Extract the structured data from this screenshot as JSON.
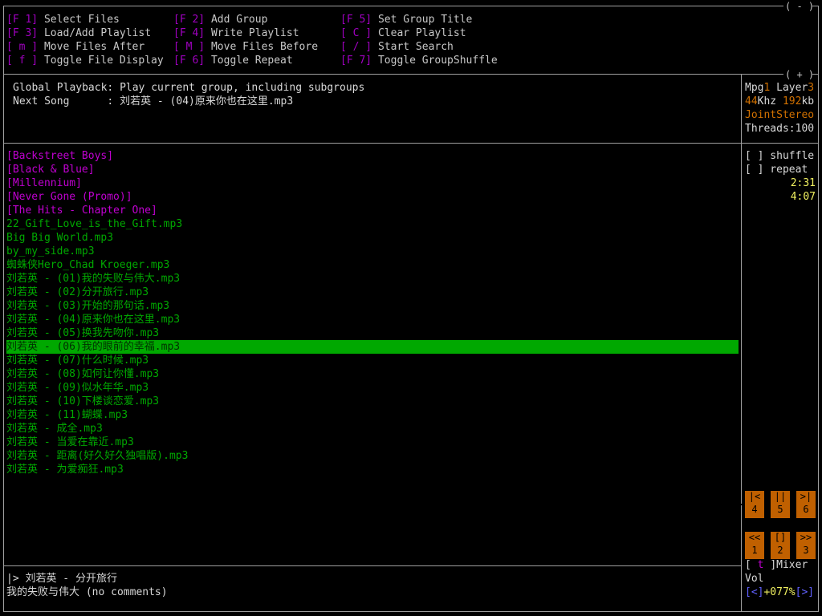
{
  "window_controls": {
    "minimize": "( - )",
    "expand": "( + )"
  },
  "keys": [
    {
      "key": "[F 1]",
      "label": "Select Files"
    },
    {
      "key": "[F 2]",
      "label": "Add Group"
    },
    {
      "key": "[F 5]",
      "label": "Set Group Title"
    },
    {
      "key": "[F 3]",
      "label": "Load/Add Playlist"
    },
    {
      "key": "[F 4]",
      "label": "Write Playlist"
    },
    {
      "key": "[ C ]",
      "label": "Clear Playlist"
    },
    {
      "key": "[ m ]",
      "label": "Move Files After"
    },
    {
      "key": "[ M ]",
      "label": "Move Files Before"
    },
    {
      "key": "[ / ]",
      "label": "Start Search"
    },
    {
      "key": "[ f ]",
      "label": "Toggle File Display"
    },
    {
      "key": "[F 6]",
      "label": "Toggle Repeat"
    },
    {
      "key": "[F 7]",
      "label": "Toggle GroupShuffle"
    }
  ],
  "info": {
    "global_label": "Global Playback:",
    "global_value": "Play current group, including subgroups",
    "next_label": "Next Song      :",
    "next_value": "刘若英 - (04)原来你也在这里.mp3"
  },
  "stream": {
    "mpg_label": "Mpg",
    "mpg_value": "1",
    "layer_label": "Layer",
    "layer_value": "3",
    "khz_value": "44",
    "khz_label": "Khz",
    "kb_value": "192",
    "kb_label": "kb",
    "mode": "JointStereo",
    "threads": "Threads:100"
  },
  "toggles": {
    "shuffle": "[ ] shuffle",
    "repeat": "[ ] repeat",
    "elapsed": "2:31",
    "total": "4:07"
  },
  "playlist": {
    "groups": [
      "[Backstreet Boys]",
      "[Black & Blue]",
      "[Millennium]",
      "[Never Gone (Promo)]",
      "[The Hits - Chapter One]"
    ],
    "files": [
      "22_Gift_Love_is_the_Gift.mp3",
      "Big Big World.mp3",
      "by_my_side.mp3",
      "蜘蛛侠Hero_Chad Kroeger.mp3",
      "刘若英 - (01)我的失败与伟大.mp3",
      "刘若英 - (02)分开旅行.mp3",
      "刘若英 - (03)开始的那句话.mp3",
      "刘若英 - (04)原来你也在这里.mp3",
      "刘若英 - (05)换我先吻你.mp3",
      "刘若英 - (06)我的眼前的幸福.mp3",
      "刘若英 - (07)什么时候.mp3",
      "刘若英 - (08)如何让你懂.mp3",
      "刘若英 - (09)似水年华.mp3",
      "刘若英 - (10)下楼谈恋爱.mp3",
      "刘若英 - (11)蝴蝶.mp3",
      "刘若英 - 成全.mp3",
      "刘若英 - 当爱在靠近.mp3",
      "刘若英 - 距离(好久好久独唱版).mp3",
      "刘若英 - 为爱痴狂.mp3"
    ],
    "selected_file_index": 9
  },
  "transport": {
    "row1": [
      {
        "sym": "|<",
        "num": "4"
      },
      {
        "sym": "||",
        "num": "5"
      },
      {
        "sym": ">|",
        "num": "6"
      }
    ],
    "row2": [
      {
        "sym": "<<",
        "num": "1"
      },
      {
        "sym": "[]",
        "num": "2"
      },
      {
        "sym": ">>",
        "num": "3"
      }
    ]
  },
  "mixer": {
    "open": "[",
    "key": " t ",
    "close": "]Mixer",
    "vol_label": "Vol",
    "vol_left": "[<]",
    "vol_value": "+077%",
    "vol_right": "[>]"
  },
  "status": {
    "line1": "|> 刘若英 - 分开旅行",
    "line2": "我的失败与伟大 (no comments)"
  }
}
